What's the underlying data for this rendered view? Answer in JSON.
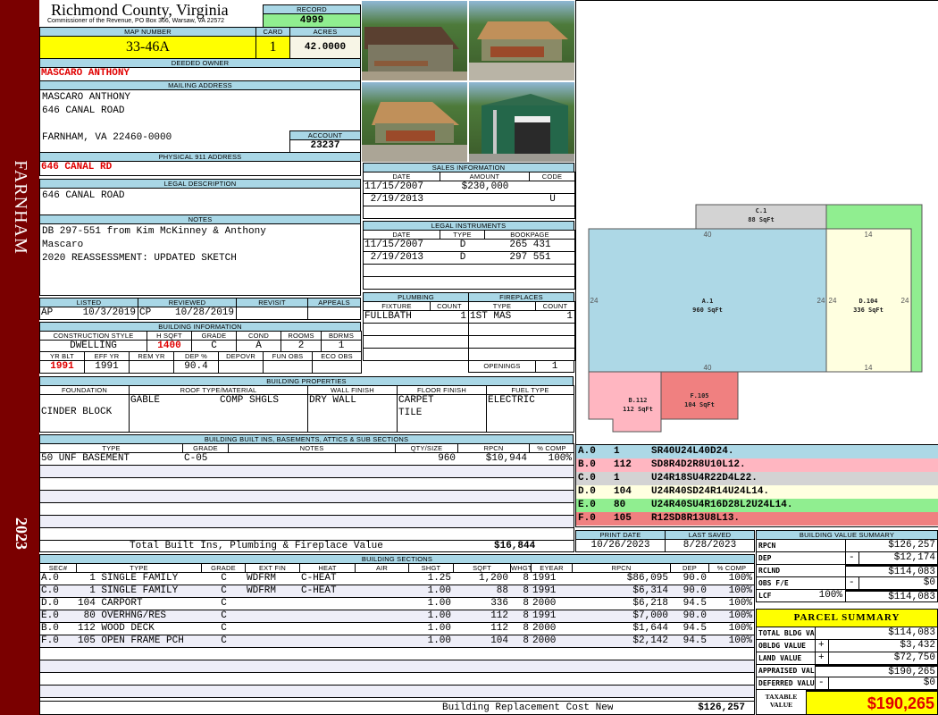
{
  "side": {
    "town": "FARNHAM",
    "year": "2023"
  },
  "header": {
    "county": "Richmond County, Virginia",
    "subtitle": "Commissioner of the Revenue, PO Box 366, Warsaw, VA 22572",
    "record_label": "RECORD",
    "record": "4999"
  },
  "parcel": {
    "map_label": "MAP NUMBER",
    "map_number": "33-46A",
    "card_label": "CARD",
    "card": "1",
    "acres_label": "ACRES",
    "acres": "42.0000"
  },
  "owner": {
    "label": "DEEDED OWNER",
    "name": "MASCARO ANTHONY"
  },
  "mailing": {
    "label": "MAILING ADDRESS",
    "line1": "MASCARO ANTHONY",
    "line2": "646 CANAL ROAD",
    "line3": "FARNHAM, VA 22460-0000",
    "account_label": "ACCOUNT",
    "account": "23237"
  },
  "physical": {
    "label": "PHYSICAL 911 ADDRESS",
    "address": "646 CANAL RD"
  },
  "legal": {
    "label": "LEGAL DESCRIPTION",
    "text": "646 CANAL ROAD"
  },
  "notes": {
    "label": "NOTES",
    "line1": "DB 297-551 from Kim McKinney & Anthony",
    "line2": "Mascaro",
    "line3": "2020 REASSESSMENT: UPDATED SKETCH"
  },
  "review": {
    "listed_label": "LISTED",
    "listed_by": "AP",
    "listed_date": "10/3/2019",
    "reviewed_label": "REVIEWED",
    "reviewed_by": "CP",
    "reviewed_date": "10/28/2019",
    "revisit_label": "REVISIT",
    "appeals_label": "APPEALS"
  },
  "building_info": {
    "label": "BUILDING INFORMATION",
    "headers1": [
      "CONSTRUCTION STYLE",
      "H SQFT",
      "GRADE",
      "COND",
      "ROOMS",
      "BDRMS"
    ],
    "values1": [
      "DWELLING",
      "1400",
      "C",
      "A",
      "2",
      "1"
    ],
    "headers2": [
      "YR BLT",
      "EFF YR",
      "REM YR",
      "DEP %",
      "DEPOVR",
      "FUN OBS",
      "ECO OBS"
    ],
    "values2": [
      "1991",
      "1991",
      "",
      "90.4",
      "",
      "",
      ""
    ]
  },
  "properties": {
    "label": "BUILDING PROPERTIES",
    "headers": [
      "FOUNDATION",
      "ROOF TYPE/MATERIAL",
      "WALL FINISH",
      "FLOOR FINISH",
      "FUEL TYPE"
    ],
    "foundation": "CINDER BLOCK",
    "roof_type": "GABLE",
    "roof_material": "COMP SHGLS",
    "wall": "DRY WALL",
    "floor1": "CARPET",
    "floor2": "TILE",
    "fuel": "ELECTRIC"
  },
  "sales": {
    "label": "SALES INFORMATION",
    "headers": [
      "DATE",
      "AMOUNT",
      "CODE"
    ],
    "rows": [
      [
        "11/15/2007",
        "$230,000",
        ""
      ],
      [
        " 2/19/2013",
        "",
        "U"
      ]
    ]
  },
  "instruments": {
    "label": "LEGAL INSTRUMENTS",
    "headers": [
      "DATE",
      "TYPE",
      "BOOKPAGE"
    ],
    "rows": [
      [
        "11/15/2007",
        "D",
        "265 431"
      ],
      [
        " 2/19/2013",
        "D",
        "297 551"
      ]
    ]
  },
  "plumbing": {
    "label": "PLUMBING",
    "headers": [
      "FIXTURE",
      "COUNT"
    ],
    "rows": [
      [
        "FULLBATH",
        "1"
      ]
    ]
  },
  "fireplaces": {
    "label": "FIREPLACES",
    "headers": [
      "TYPE",
      "COUNT"
    ],
    "rows": [
      [
        "1ST MAS",
        "1"
      ]
    ],
    "openings_label": "OPENINGS",
    "openings": "1"
  },
  "builtins": {
    "label": "BUILDING BUILT INS, BASEMENTS, ATTICS & SUB SECTIONS",
    "headers": [
      "TYPE",
      "GRADE",
      "NOTES",
      "QTY/SIZE",
      "RPCN",
      "% COMP"
    ],
    "rows": [
      [
        "50 UNF BASEMENT",
        "C-05",
        "",
        "960",
        "$10,944",
        "100%"
      ]
    ],
    "total_label": "Total Built Ins, Plumbing & Fireplace Value",
    "total": "$16,844"
  },
  "sections": {
    "label": "BUILDING SECTIONS",
    "headers": [
      "SEC#",
      "TYPE",
      "GRADE",
      "EXT FIN",
      "HEAT",
      "AIR",
      "SHGT",
      "SQFT",
      "WHGT",
      "EYEAR",
      "RPCN",
      "DEP",
      "% COMP"
    ],
    "rows": [
      [
        "A.0",
        "  1 SINGLE FAMILY",
        "C",
        "WDFRM",
        "C-HEAT",
        "",
        "1.25",
        "1,200",
        "8",
        "1991",
        "$86,095",
        "90.0",
        "100%"
      ],
      [
        "C.0",
        "  1 SINGLE FAMILY",
        "C",
        "WDFRM",
        "C-HEAT",
        "",
        "1.00",
        "88",
        "8",
        "1991",
        "$6,314",
        "90.0",
        "100%"
      ],
      [
        "D.0",
        "104 CARPORT",
        "C",
        "",
        "",
        "",
        "1.00",
        "336",
        "8",
        "2000",
        "$6,218",
        "94.5",
        "100%"
      ],
      [
        "E.0",
        " 80 OVERHNG/RES",
        "C",
        "",
        "",
        "",
        "1.00",
        "112",
        "8",
        "1991",
        "$7,000",
        "90.0",
        "100%"
      ],
      [
        "B.0",
        "112 WOOD DECK",
        "C",
        "",
        "",
        "",
        "1.00",
        "112",
        "8",
        "2000",
        "$1,644",
        "94.5",
        "100%"
      ],
      [
        "F.0",
        "105 OPEN FRAME PCH",
        "C",
        "",
        "",
        "",
        "1.00",
        "104",
        "8",
        "2000",
        "$2,142",
        "94.5",
        "100%"
      ]
    ],
    "total_label": "Building Replacement Cost New",
    "total": "$126,257"
  },
  "sketch": {
    "areas": [
      {
        "code": "A.1",
        "sqft": "960 SqFt",
        "color": "#add8e6"
      },
      {
        "code": "C.1",
        "sqft": "88 SqFt",
        "color": "#d3d3d3"
      },
      {
        "code": "D.104",
        "sqft": "336 SqFt",
        "color": "#ffffe0"
      },
      {
        "code": "B.112",
        "sqft": "112 SqFt",
        "color": "#ffb6c1"
      },
      {
        "code": "F.105",
        "sqft": "104 SqFt",
        "color": "#f08080"
      },
      {
        "code": "E.80",
        "sqft": "",
        "color": "#90ee90"
      }
    ],
    "dims": {
      "a_top": "40",
      "a_bottom": "40",
      "a_left": "24",
      "a_right": "24",
      "d_top": "14",
      "d_bottom": "14",
      "d_left": "24",
      "d_right": "24"
    }
  },
  "segments": [
    [
      "A.0",
      "1",
      "SR40U24L40D24."
    ],
    [
      "B.0",
      "112",
      "SD8R4D2R8U10L12."
    ],
    [
      "C.0",
      "1",
      "U24R18SU4R22D4L22."
    ],
    [
      "D.0",
      "104",
      "U24R40SD24R14U24L14."
    ],
    [
      "E.0",
      "80",
      "U24R40SU4R16D28L2U24L14."
    ],
    [
      "F.0",
      "105",
      "R12SD8R13U8L13."
    ]
  ],
  "segment_colors": [
    "#add8e6",
    "#ffb6c1",
    "#d3d3d3",
    "#ffffe0",
    "#90ee90",
    "#f08080"
  ],
  "dates": {
    "print_label": "PRINT DATE",
    "print": "10/26/2023",
    "saved_label": "LAST SAVED",
    "saved": "8/28/2023"
  },
  "value_summary": {
    "label": "BUILDING VALUE SUMMARY",
    "rows": [
      {
        "label": "RPCN",
        "extra": "",
        "sign": "",
        "value": "$126,257"
      },
      {
        "label": "DEP",
        "extra": "",
        "sign": "-",
        "value": "$12,174"
      },
      {
        "label": "RCLND",
        "extra": "",
        "sign": "",
        "value": "$114,083"
      },
      {
        "label": "OBS F/E",
        "extra": "",
        "sign": "-",
        "value": "$0"
      },
      {
        "label": "LCF",
        "extra": "100%",
        "sign": "",
        "value": "$114,083"
      }
    ]
  },
  "parcel_summary": {
    "label": "PARCEL SUMMARY",
    "rows": [
      {
        "label": "TOTAL BLDG VALUE",
        "sign": "",
        "value": "$114,083"
      },
      {
        "label": "OBLDG VALUE",
        "sign": "+",
        "value": "$3,432"
      },
      {
        "label": "LAND VALUE",
        "sign": "+",
        "value": "$72,750"
      },
      {
        "label": "APPRAISED VALUE",
        "sign": "",
        "value": "$190,265"
      },
      {
        "label": "DEFERRED VALUE",
        "sign": "-",
        "value": "$0"
      }
    ],
    "taxable_label1": "TAXABLE",
    "taxable_label2": "VALUE",
    "taxable": "$190,265"
  },
  "colors": {
    "side": "#7a0000",
    "header": "#a9d7e6",
    "highlight": "#ffff00",
    "record": "#90ee90"
  }
}
